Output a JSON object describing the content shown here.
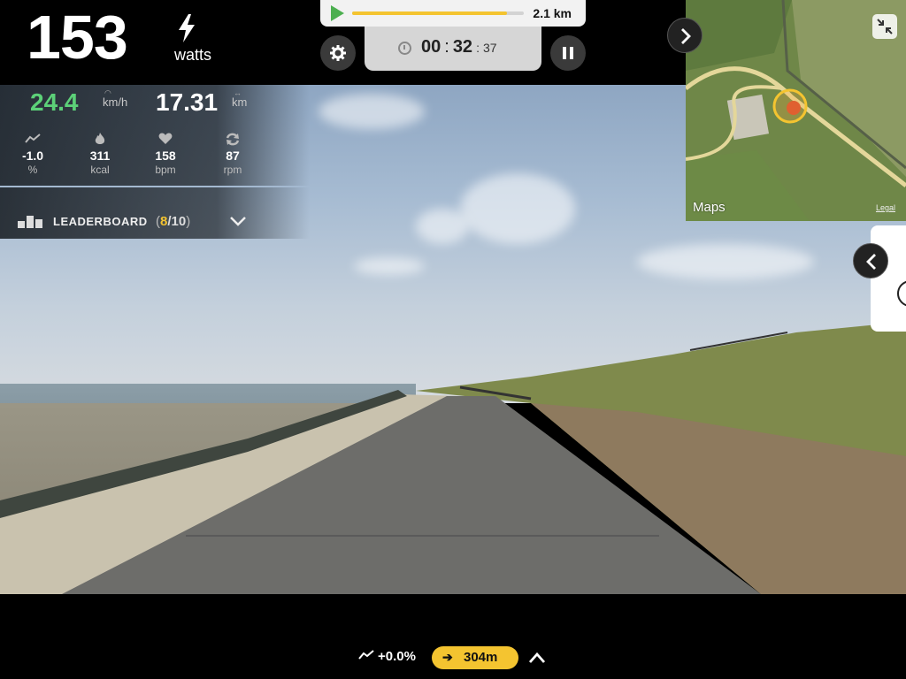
{
  "power": {
    "value": "153",
    "unit": "watts"
  },
  "route": {
    "total_distance": "2.1 km",
    "progress": 0.9
  },
  "timer": {
    "hours": "00",
    "minutes": "32",
    "seconds": "37",
    "sep": ":"
  },
  "metrics": {
    "speed": {
      "value": "24.4",
      "unit": "km/h"
    },
    "distance": {
      "value": "17.31",
      "unit": "km"
    },
    "stats": [
      {
        "icon": "grade-icon",
        "value": "-1.0",
        "label": "%"
      },
      {
        "icon": "flame-icon",
        "value": "311",
        "label": "kcal"
      },
      {
        "icon": "heart-icon",
        "value": "158",
        "label": "bpm"
      },
      {
        "icon": "cadence-icon",
        "value": "87",
        "label": "rpm"
      }
    ]
  },
  "leaderboard": {
    "label": "LEADERBOARD",
    "position": "8",
    "total": "10",
    "separator": "/",
    "open_paren": "(",
    "close_paren": ")"
  },
  "map": {
    "brand": "Maps",
    "legal": "Legal"
  },
  "bottom": {
    "slope": "+0.0%",
    "distance_ahead": "304m",
    "arrow": "➔"
  },
  "colors": {
    "accent": "#f4c430",
    "speed_green": "#5cd178",
    "play_green": "#4caf50"
  }
}
